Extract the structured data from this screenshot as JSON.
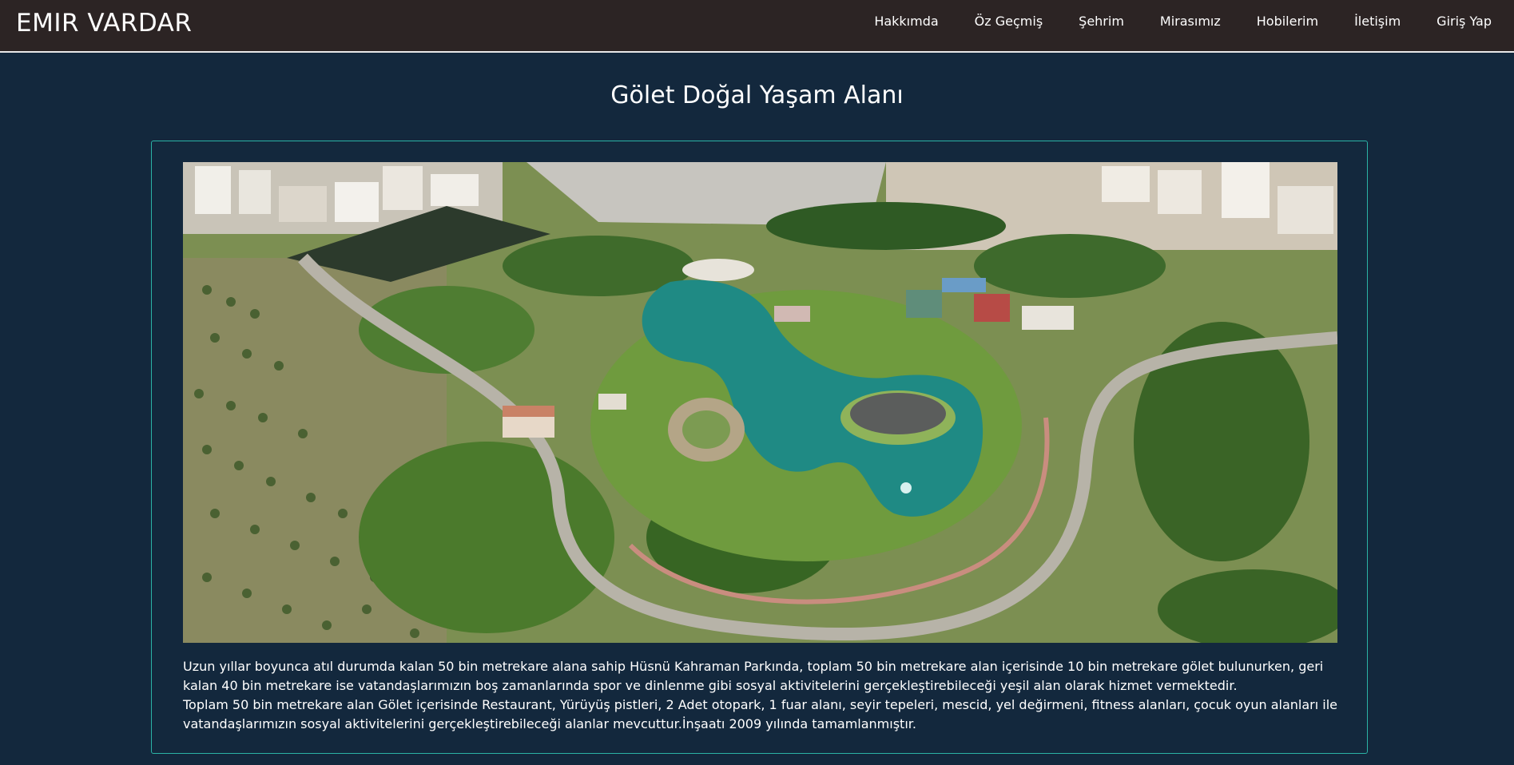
{
  "header": {
    "brand": "EMIR VARDAR",
    "nav": [
      {
        "label": "Hakkımda"
      },
      {
        "label": "Öz Geçmiş"
      },
      {
        "label": "Şehrim"
      },
      {
        "label": "Mirasımız"
      },
      {
        "label": "Hobilerim"
      },
      {
        "label": "İletişim"
      },
      {
        "label": "Giriş Yap"
      }
    ]
  },
  "main": {
    "title": "Gölet Doğal Yaşam Alanı",
    "image": {
      "subject": "aerial photo of park with pond"
    },
    "paragraph1": "Uzun yıllar boyunca atıl durumda kalan 50 bin metrekare alana sahip Hüsnü Kahraman Parkında, toplam 50 bin metrekare alan içerisinde 10 bin metrekare gölet bulunurken, geri kalan 40 bin metrekare ise vatandaşlarımızın boş zamanlarında spor ve dinlenme gibi sosyal aktivitelerini gerçekleştirebileceği yeşil alan olarak hizmet vermektedir.",
    "paragraph2": "Toplam 50 bin metrekare alan Gölet içerisinde Restaurant, Yürüyüş pistleri, 2 Adet otopark, 1 fuar alanı, seyir tepeleri, mescid, yel değirmeni, fitness alanları, çocuk oyun alanları ile vatandaşlarımızın sosyal aktivitelerini gerçekleştirebileceği alanlar mevcuttur.İnşaatı 2009 yılında tamamlanmıştır."
  },
  "colors": {
    "navbar": "#2c2424",
    "background": "#13283d",
    "card_border": "#2bb3a6",
    "text": "#ffffff"
  }
}
